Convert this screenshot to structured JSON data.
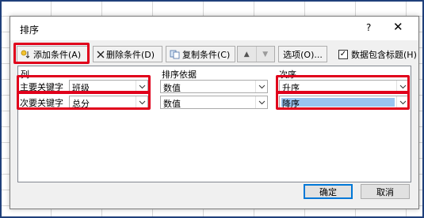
{
  "dialog": {
    "title": "排序",
    "help": "?",
    "close": "✕"
  },
  "toolbar": {
    "add_label": "添加条件(A)",
    "delete_label": "删除条件(D)",
    "copy_label": "复制条件(C)",
    "move_up": "▲",
    "move_down": "▼",
    "options_label": "选项(O)...",
    "header_checkbox_label": "数据包含标题(H)",
    "header_checkbox_checked": "✓"
  },
  "columns": {
    "col": "列",
    "basis": "排序依据",
    "order": "次序"
  },
  "rows": [
    {
      "label": "主要关键字",
      "column": "班级",
      "basis": "数值",
      "order": "升序"
    },
    {
      "label": "次要关键字",
      "column": "总分",
      "basis": "数值",
      "order": "降序"
    }
  ],
  "footer": {
    "ok_label": "确定",
    "cancel_label": "取消"
  },
  "colors": {
    "highlight": "#e0001b",
    "selection": "#99c4f0",
    "frame": "#1f3f7a"
  }
}
